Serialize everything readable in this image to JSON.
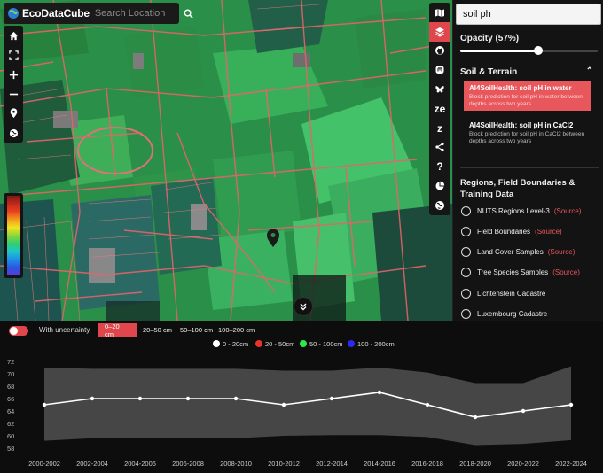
{
  "app": {
    "brand": "EcoDataCube"
  },
  "search": {
    "placeholder": "Search Location"
  },
  "map_tools": {
    "items": [
      {
        "name": "home-icon"
      },
      {
        "name": "fullscreen-icon"
      },
      {
        "name": "zoom-in-icon"
      },
      {
        "name": "zoom-out-icon"
      },
      {
        "name": "location-icon"
      },
      {
        "name": "globe-icon"
      }
    ]
  },
  "icon_column": {
    "items": [
      {
        "name": "map-icon",
        "text": ""
      },
      {
        "name": "layers-icon",
        "text": "",
        "active": true
      },
      {
        "name": "github-icon",
        "text": ""
      },
      {
        "name": "mastodon-icon",
        "text": ""
      },
      {
        "name": "bluesky-icon",
        "text": ""
      },
      {
        "name": "zenodo-icon",
        "text": "ze"
      },
      {
        "name": "z-icon",
        "text": "z"
      },
      {
        "name": "share-icon",
        "text": ""
      },
      {
        "name": "help-icon",
        "text": "?"
      },
      {
        "name": "pie-chart-icon",
        "text": ""
      },
      {
        "name": "earth-icon",
        "text": ""
      }
    ]
  },
  "panel": {
    "layer_search_value": "soil ph",
    "opacity_label": "Opacity (57%)",
    "opacity_value": 0.57,
    "section_soil": "Soil & Terrain",
    "layers": [
      {
        "title": "AI4SoilHealth: soil pH in water",
        "desc": "Block prediction for soil pH in water between depths across two years",
        "active": true
      },
      {
        "title": "AI4SoilHealth: soil pH in CaCl2",
        "desc": "Block prediction for soil pH in CaCl2 between depths across two years",
        "active": false
      }
    ],
    "section_regions": "Regions, Field Boundaries & Training Data",
    "regions": [
      {
        "label": "NUTS Regions Level-3",
        "source": "(Source)"
      },
      {
        "label": "Field Boundaries",
        "source": "(Source)"
      },
      {
        "label": "Land Cover Samples",
        "source": "(Source)"
      },
      {
        "label": "Tree Species Samples",
        "source": "(Source)"
      },
      {
        "label": "Lichtenstein Cadastre",
        "source": ""
      },
      {
        "label": "Luxembourg Cadastre",
        "source": ""
      }
    ]
  },
  "bottom": {
    "uncertainty_label": "With uncertainty",
    "uncertainty_on": true,
    "depth_buttons": [
      {
        "label": "0–20 cm",
        "active": true
      },
      {
        "label": "20–50 cm",
        "active": false
      },
      {
        "label": "50–100 cm",
        "active": false
      },
      {
        "label": "100–200 cm",
        "active": false
      }
    ]
  },
  "chart_data": {
    "type": "line",
    "title": "",
    "xlabel": "",
    "ylabel": "",
    "categories": [
      "2000-2002",
      "2002-2004",
      "2004-2006",
      "2006-2008",
      "2008-2010",
      "2010-2012",
      "2012-2014",
      "2014-2016",
      "2016-2018",
      "2018-2020",
      "2020-2022",
      "2022-2024"
    ],
    "ylim": [
      58,
      72
    ],
    "yticks": [
      58,
      60,
      62,
      64,
      66,
      68,
      70,
      72
    ],
    "legend": {
      "placement": "top",
      "entries": [
        {
          "name": "0 - 20cm",
          "color": "#ffffff"
        },
        {
          "name": "20 - 50cm",
          "color": "#e8332a"
        },
        {
          "name": "50 - 100cm",
          "color": "#2ee64a"
        },
        {
          "name": "100 - 200cm",
          "color": "#2b2bf0"
        }
      ]
    },
    "series": [
      {
        "name": "0 - 20cm",
        "color": "#ffffff",
        "values": [
          65,
          66,
          66,
          66,
          66,
          65,
          66,
          67,
          65,
          63,
          64,
          65
        ],
        "upper": [
          71,
          70.8,
          70.8,
          70.8,
          70.8,
          70.5,
          70.5,
          71,
          70.2,
          68.5,
          68.5,
          71.2
        ],
        "lower": [
          59.2,
          59.6,
          59.6,
          59.6,
          59.6,
          60,
          60.1,
          60.1,
          59.8,
          58.5,
          58.7,
          59.3
        ]
      }
    ],
    "grid": false
  }
}
